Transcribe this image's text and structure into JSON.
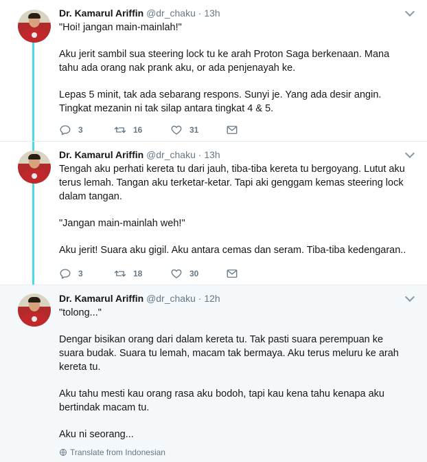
{
  "tweets": [
    {
      "name": "Dr. Kamarul Ariffin",
      "handle": "@dr_chaku",
      "sep": "·",
      "time": "13h",
      "paragraphs": [
        "\"Hoi! jangan main-mainlah!\"",
        "Aku jerit sambil sua steering lock tu ke arah Proton Saga berkenaan. Mana tahu ada orang nak prank aku, or ada penjenayah ke.",
        "Lepas 5 minit, tak ada sebarang respons. Sunyi je. Yang ada desir angin. Tingkat mezanin ni tak silap antara tingkat 4 & 5."
      ],
      "replies": "3",
      "retweets": "16",
      "likes": "31"
    },
    {
      "name": "Dr. Kamarul Ariffin",
      "handle": "@dr_chaku",
      "sep": "·",
      "time": "13h",
      "paragraphs": [
        "Tengah aku perhati kereta tu dari jauh, tiba-tiba kereta tu bergoyang. Lutut aku terus lemah. Tangan aku terketar-ketar. Tapi aki genggam kemas steering lock dalam tangan.",
        "\"Jangan main-mainlah weh!\"",
        "Aku jerit! Suara aku gigil. Aku antara cemas dan seram. Tiba-tiba kedengaran.."
      ],
      "replies": "3",
      "retweets": "18",
      "likes": "30"
    },
    {
      "name": "Dr. Kamarul Ariffin",
      "handle": "@dr_chaku",
      "sep": "·",
      "time": "12h",
      "paragraphs": [
        "\"tolong...\"",
        "Dengar bisikan orang dari dalam kereta tu. Tak pasti suara perempuan ke suara budak. Suara tu lemah, macam tak bermaya. Aku terus meluru ke arah kereta tu.",
        "Aku tahu mesti kau orang rasa aku bodoh, tapi kau kena tahu kenapa aku bertindak macam tu.",
        "Aku ni seorang..."
      ],
      "translate": "Translate from Indonesian"
    }
  ],
  "icons": {
    "reply": "reply-icon",
    "retweet": "retweet-icon",
    "like": "heart-icon",
    "dm": "envelope-icon",
    "globe": "globe-icon"
  },
  "colors": {
    "thread_line": "#4ad9e8",
    "secondary_text": "#657786",
    "highlight_bg": "#f5f8fa"
  }
}
